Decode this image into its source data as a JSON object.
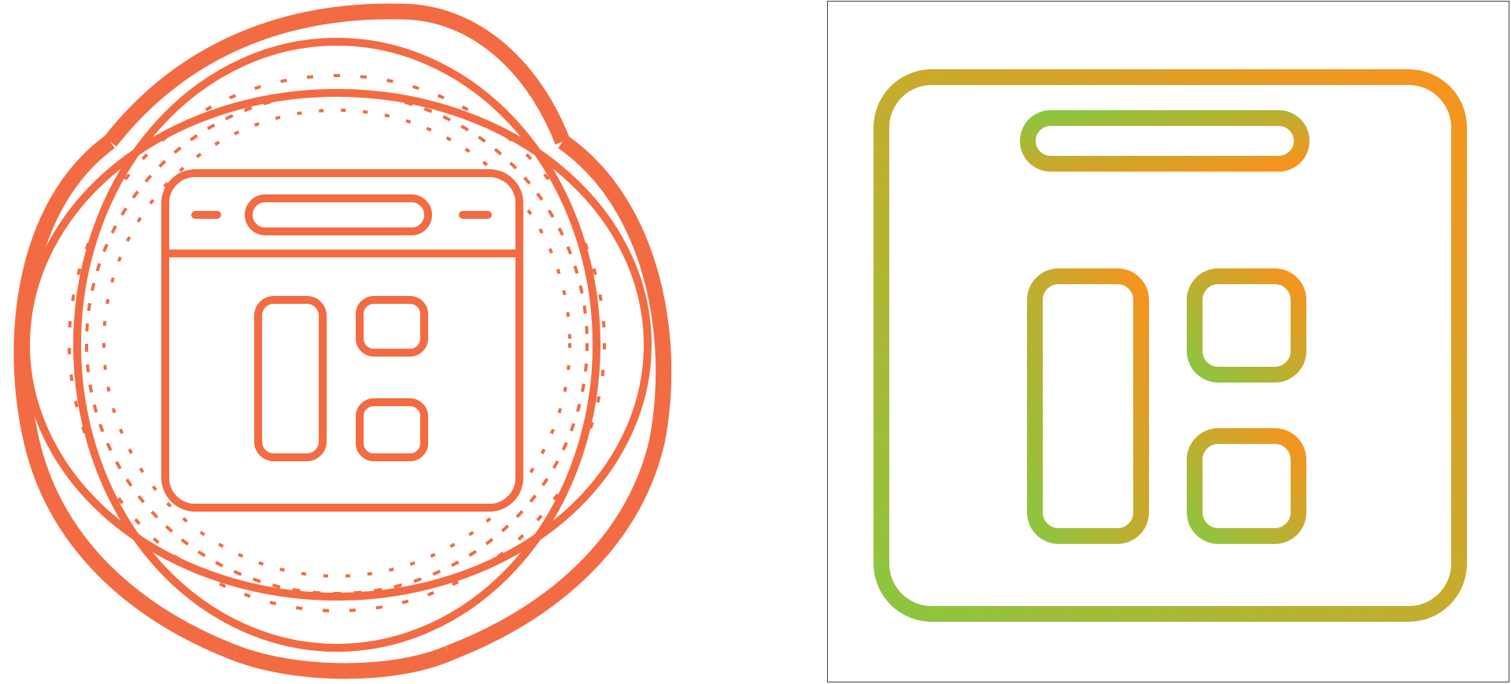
{
  "icons": [
    {
      "name": "browser-layout-icon",
      "style": "circular-badge",
      "stroke_color": "#f26b43"
    },
    {
      "name": "browser-layout-icon",
      "style": "gradient-line",
      "gradient_colors": [
        "#8cc63f",
        "#f7931e"
      ]
    }
  ]
}
